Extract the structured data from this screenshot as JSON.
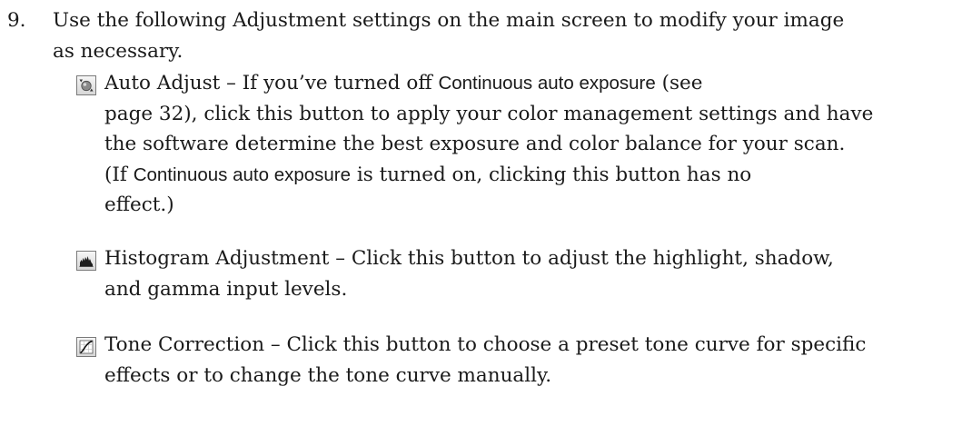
{
  "step": {
    "number": "9.",
    "text_line1": "Use the following Adjustment settings on the main screen to modify your image",
    "text_line2": "as necessary."
  },
  "items": [
    {
      "icon": "auto-adjust-icon",
      "line1_pre": "Auto Adjust – If you’ve turned off ",
      "line1_term": "Continuous auto exposure",
      "line1_post": " (see",
      "line2": "page 32), click this button to apply your color management settings and have",
      "line3": "the software determine the best exposure and color balance for your scan.",
      "line4_pre": "(If ",
      "line4_term": "Continuous auto exposure",
      "line4_post": " is turned on, clicking this button has no",
      "line5": "effect.)"
    },
    {
      "icon": "histogram-icon",
      "line1": "Histogram Adjustment – Click this button to adjust the highlight, shadow,",
      "line2": "and gamma input levels."
    },
    {
      "icon": "tone-curve-icon",
      "line1": "Tone Correction – Click this button to choose a preset tone curve for specific",
      "line2": "effects or to change the tone curve manually."
    }
  ]
}
